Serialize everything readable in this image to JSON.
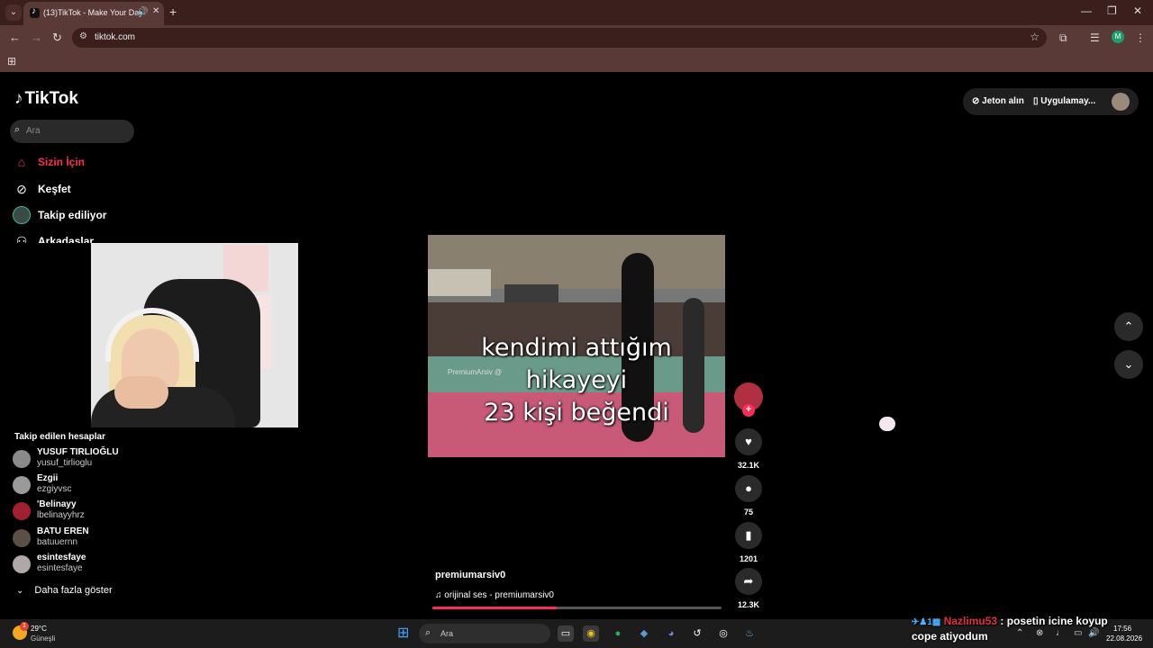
{
  "browser": {
    "tab_title": "(13)TikTok - Make Your Day",
    "url": "tiktok.com",
    "profile_initial": "M"
  },
  "tiktok": {
    "logo": "TikTok",
    "search_placeholder": "Ara",
    "nav": [
      {
        "label": "Sizin İçin",
        "icon": "home-icon"
      },
      {
        "label": "Keşfet",
        "icon": "compass-icon"
      },
      {
        "label": "Takip ediliyor",
        "icon": "avatar"
      },
      {
        "label": "Arkadaşlar",
        "icon": "friends-icon"
      }
    ],
    "followed_title": "Takip edilen hesaplar",
    "followed": [
      {
        "name": "YUSUF TIRLIOĞLU",
        "handle": "yusuf_tirlioglu"
      },
      {
        "name": "Ezgii",
        "handle": "ezgiyvsc"
      },
      {
        "name": "'Belinayy",
        "handle": "lbelinayyhrz"
      },
      {
        "name": "BATU EREN",
        "handle": "batuuernn"
      },
      {
        "name": "esintesfaye",
        "handle": "esintesfaye"
      }
    ],
    "show_more": "Daha fazla göster",
    "get_coins": "Jeton alın",
    "get_app": "Uygulamay...",
    "video": {
      "caption_lines": [
        "kendimi attığım",
        "hikayeyi",
        "23 kişi beğendi"
      ],
      "watermark": "PremiumArsiv @",
      "author": "premiumarsiv0",
      "music": "orijinal ses - premiumarsiv0",
      "progress": 0.43
    },
    "actions": {
      "likes": "32.1K",
      "comments": "75",
      "saves": "1201",
      "shares": "12.3K"
    }
  },
  "taskbar": {
    "temperature": "29°C",
    "weather": "Güneşli",
    "weather_badge": "1",
    "search_label": "Ara",
    "time": "17:56",
    "date": "22.08.2026"
  },
  "chat": {
    "badge": "1",
    "user": "Nazlimu53",
    "message": ": posetin icine koyup",
    "message_cont": "cope atiyodum"
  },
  "colors": {
    "accent": "#fe2c55",
    "chrome_dark": "#3a1f1d",
    "chrome": "#5a3a37"
  }
}
